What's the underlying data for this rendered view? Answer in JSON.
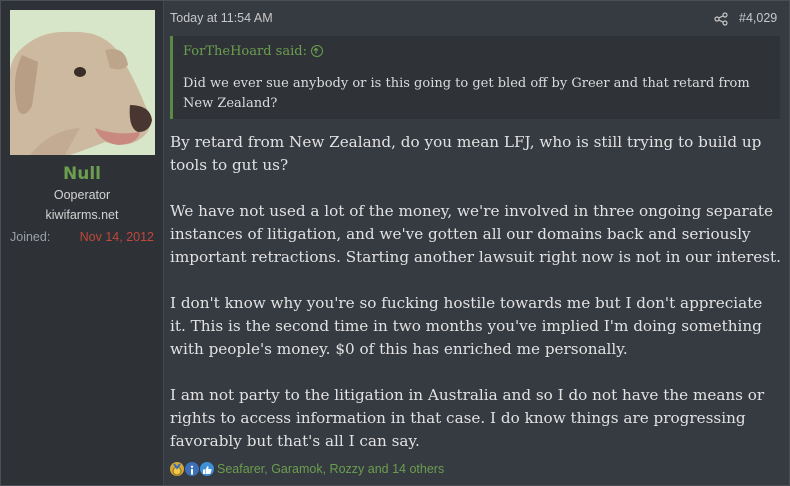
{
  "user": {
    "name": "Null",
    "title": "Ooperator",
    "banner": "kiwifarms.net",
    "joined_label": "Joined:",
    "joined_value": "Nov 14, 2012"
  },
  "post": {
    "timestamp": "Today at 11:54 AM",
    "number": "#4,029"
  },
  "quote": {
    "author_line": "ForTheHoard said:",
    "text": "Did we ever sue anybody or is this going to get bled off by Greer and that retard from New Zealand?"
  },
  "message": {
    "paragraphs": [
      "By retard from New Zealand, do you mean LFJ, who is still trying to build up tools to gut us?",
      "We have not used a lot of the money, we're involved in three ongoing separate instances of litigation, and we've gotten all our domains back and seriously important retractions. Starting another lawsuit right now is not in our interest.",
      "I don't know why you're so fucking hostile towards me but I don't appreciate it. This is the second time in two months you've implied I'm doing something with people's money. $0 of this has enriched me personally.",
      "I am not party to the litigation in Australia and so I do not have the means or rights to access information in that case. I do know things are progressing favorably but that's all I can say."
    ]
  },
  "reactions": {
    "list": "Seafarer, Garamok, Rozzy and 14 others",
    "icons": [
      "medal-icon",
      "informative-icon",
      "like-icon"
    ]
  },
  "colors": {
    "accent_green": "#6b9e4e",
    "joined_red": "#c0473a",
    "background": "#363a41"
  }
}
